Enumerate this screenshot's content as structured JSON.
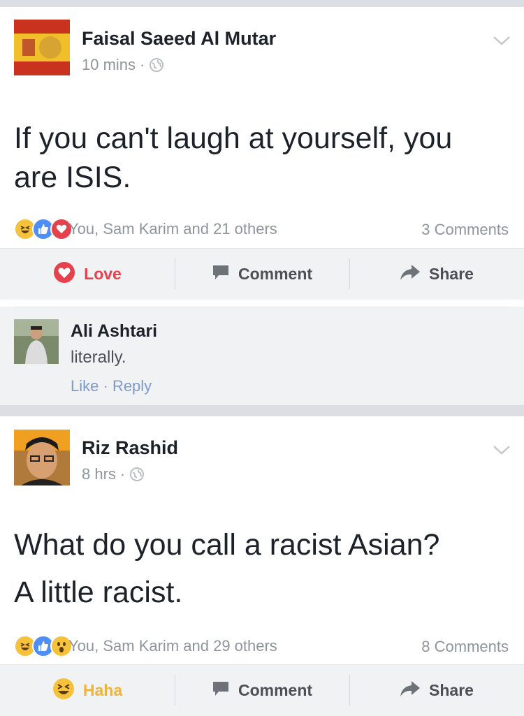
{
  "posts": [
    {
      "author": "Faisal Saeed Al Mutar",
      "time": "10 mins",
      "separator": "·",
      "privacy_icon": "globe-icon",
      "text_lines": [
        "If you can't laugh at yourself, you",
        "are ISIS."
      ],
      "reaction_icons": [
        "haha-icon",
        "like-icon",
        "love-icon"
      ],
      "reactions_text": "You, Sam Karim and 21 others",
      "comments_count": "3 Comments",
      "actions": {
        "react": "Love",
        "comment": "Comment",
        "share": "Share"
      },
      "comment": {
        "author": "Ali Ashtari",
        "text": "literally.",
        "like": "Like",
        "sep": "·",
        "reply": "Reply"
      }
    },
    {
      "author": "Riz Rashid",
      "time": "8 hrs",
      "separator": "·",
      "privacy_icon": "globe-icon",
      "text_lines": [
        "What do you call a racist Asian?",
        "A little racist."
      ],
      "reaction_icons": [
        "haha-icon",
        "like-icon",
        "wow-icon"
      ],
      "reactions_text": "You, Sam Karim and 29 others",
      "comments_count": "8 Comments",
      "actions": {
        "react": "Haha",
        "comment": "Comment",
        "share": "Share"
      }
    }
  ],
  "colors": {
    "love": "#e5424d",
    "like": "#4f8df7",
    "haha": "#f7c23b",
    "meta": "#90949c",
    "link": "#7f9ac8"
  }
}
